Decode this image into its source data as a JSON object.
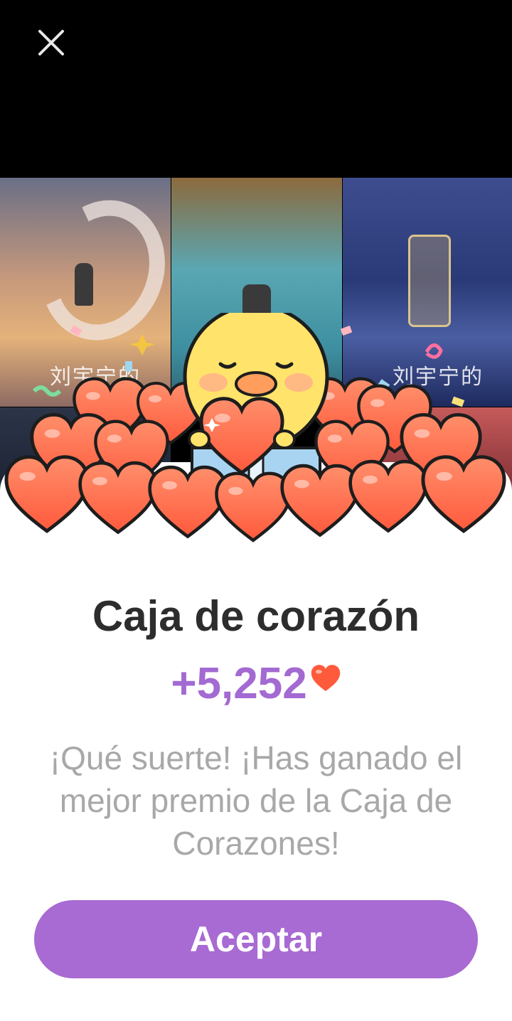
{
  "dialog": {
    "title": "Caja de corazón",
    "reward_amount": "+5,252",
    "message": "¡Qué suerte! ¡Has ganado el mejor premio de la Caja de Corazones!",
    "accept_label": "Aceptar"
  },
  "icons": {
    "close": "close-icon",
    "reward_heart": "heart-icon",
    "illustration": "chick-with-hearts-illustration"
  },
  "colors": {
    "accent": "#A86AD3",
    "reward_text": "#A36AD2",
    "title_text": "#2D2D2D",
    "message_text": "#A8A8A8",
    "heart": "#FF6A4D"
  }
}
